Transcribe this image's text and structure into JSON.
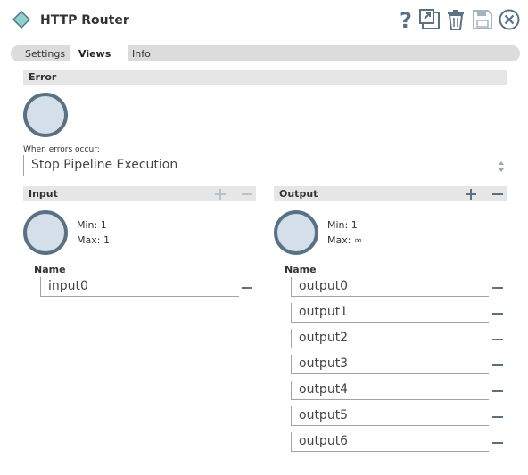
{
  "header": {
    "title": "HTTP Router",
    "icons": [
      "diamond-snap-icon",
      "help-icon",
      "export-icon",
      "delete-icon",
      "save-icon",
      "close-icon"
    ]
  },
  "tabs": [
    {
      "label": "Settings",
      "active": false
    },
    {
      "label": "Views",
      "active": true
    },
    {
      "label": "Info",
      "active": false
    }
  ],
  "error": {
    "section_title": "Error",
    "when_label": "When errors occur:",
    "selected": "Stop Pipeline Execution"
  },
  "input": {
    "section_title": "Input",
    "min": "Min: 1",
    "max": "Max: 1",
    "name_label": "Name",
    "views": [
      "input0"
    ]
  },
  "output": {
    "section_title": "Output",
    "min": "Min: 1",
    "max": "Max: ∞",
    "name_label": "Name",
    "views": [
      "output0",
      "output1",
      "output2",
      "output3",
      "output4",
      "output5",
      "output6"
    ]
  },
  "colors": {
    "icon": "#5a7184",
    "circle_fill": "#d5dfe9",
    "diamond_fill": "#8fd3d1",
    "section_bg": "#e6e6e6",
    "tab_bg": "#dcdcdc"
  }
}
